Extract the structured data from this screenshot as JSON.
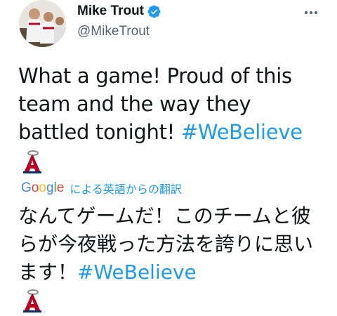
{
  "author": {
    "name": "Mike Trout",
    "handle": "@MikeTrout",
    "verified": true,
    "avatar_icon": "avatar-photo"
  },
  "more_icon": "more-options-icon",
  "tweet": {
    "text": "What a game! Proud of this team and the way they battled tonight! ",
    "hashtag": "#WeBelieve",
    "emoji_icon": "angels-logo-icon"
  },
  "translation": {
    "provider": "Google",
    "label": "による英語からの翻訳",
    "text": "なんてゲームだ！このチームと彼らが今夜戦った方法を誇りに思います！",
    "hashtag": "#WeBelieve"
  },
  "colors": {
    "link": "#1d9bf0",
    "text": "#0f1419",
    "secondary": "#536471",
    "angels_red": "#ba0021"
  }
}
